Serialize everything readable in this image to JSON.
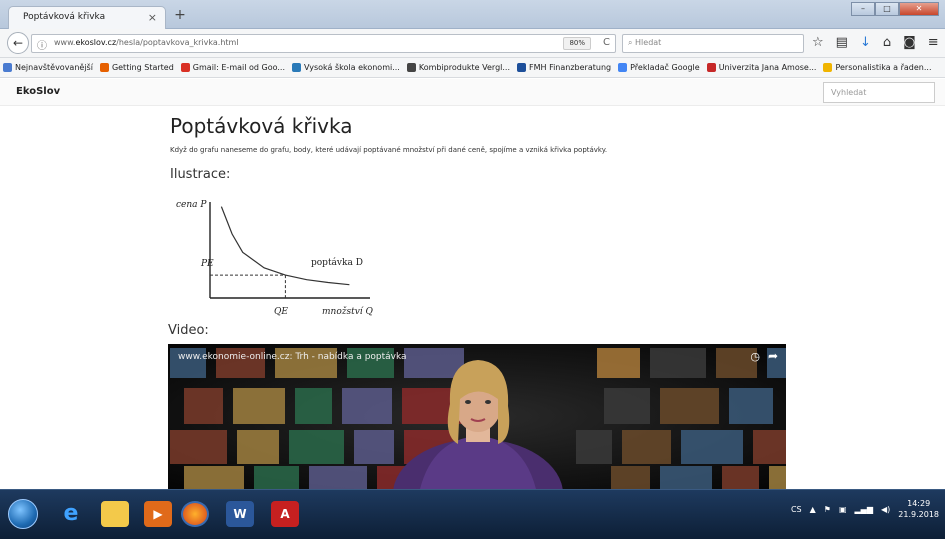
{
  "browser": {
    "tab_title": "Poptávková křivka",
    "tab_close": "×",
    "new_tab": "+",
    "url_prefix": "www.",
    "url_domain": "ekoslov.cz",
    "url_path": "/hesla/poptavkova_krivka.html",
    "zoom": "80%",
    "search_placeholder": "Hledat",
    "bookmarks": [
      {
        "label": "Nejnavštěvovanější",
        "color": "#4a7bd0"
      },
      {
        "label": "Getting Started",
        "color": "#e66000"
      },
      {
        "label": "Gmail: E-mail od Goo...",
        "color": "#d93025"
      },
      {
        "label": "Vysoká škola ekonomi...",
        "color": "#2a7ab8"
      },
      {
        "label": "Kombiprodukte Vergl...",
        "color": "#444444"
      },
      {
        "label": "FMH Finanzberatung",
        "color": "#1d4f9a"
      },
      {
        "label": "Překladač Google",
        "color": "#4285f4"
      },
      {
        "label": "Univerzita Jana Amose...",
        "color": "#c62828"
      },
      {
        "label": "Personalistika a řaden...",
        "color": "#f0b400"
      }
    ]
  },
  "site": {
    "brand": "EkoSlov",
    "search_placeholder": "Vyhledat"
  },
  "page": {
    "title": "Poptávková křivka",
    "intro": "Když do grafu naneseme do grafu, body, které udávají poptávané množství při dané ceně, spojíme a vzniká křivka poptávky.",
    "illustration_heading": "Ilustrace:",
    "video_heading": "Video:"
  },
  "chart_data": {
    "type": "line",
    "ylabel": "cena P",
    "xlabel": "množství Q",
    "series": [
      {
        "name": "poptávka D",
        "points": [
          [
            1.0,
            10.0
          ],
          [
            1.5,
            7.0
          ],
          [
            2.0,
            5.0
          ],
          [
            3.0,
            3.3
          ],
          [
            4.0,
            2.5
          ],
          [
            5.0,
            2.0
          ],
          [
            6.0,
            1.7
          ],
          [
            7.0,
            1.45
          ]
        ]
      }
    ],
    "equilibrium_price_label": "PE",
    "equilibrium_quantity_label": "QE",
    "equilibrium": {
      "x": 4.0,
      "y": 2.5
    }
  },
  "video": {
    "title": "www.ekonomie-online.cz: Trh - nabídka a poptávka"
  },
  "taskbar": {
    "lang": "CS",
    "time": "14:29",
    "date": "21.9.2018"
  },
  "colors": {
    "accent": "#1f6bb3",
    "link": "#0066cc"
  }
}
